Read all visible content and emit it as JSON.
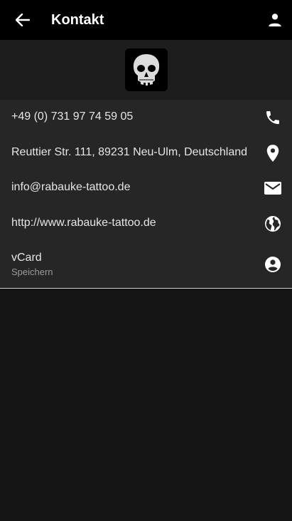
{
  "header": {
    "title": "Kontakt",
    "back_icon": "arrow-left-icon",
    "profile_icon": "person-icon"
  },
  "logo": {
    "icon": "skull-logo"
  },
  "contact": {
    "phone": {
      "label": "+49 (0) 731 97 74 59 05",
      "icon": "phone-icon"
    },
    "address": {
      "label": "Reuttier Str. 111, 89231 Neu-Ulm, Deutschland",
      "icon": "map-pin-icon"
    },
    "email": {
      "label": "info@rabauke-tattoo.de",
      "icon": "mail-icon"
    },
    "website": {
      "label": "http://www.rabauke-tattoo.de",
      "icon": "globe-icon"
    },
    "vcard": {
      "label": "vCard",
      "sublabel": "Speichern",
      "icon": "account-circle-icon"
    }
  },
  "colors": {
    "header_bg": "#000000",
    "logo_band_bg": "#1d1d1d",
    "list_bg": "#262626",
    "page_bg": "#141414"
  }
}
